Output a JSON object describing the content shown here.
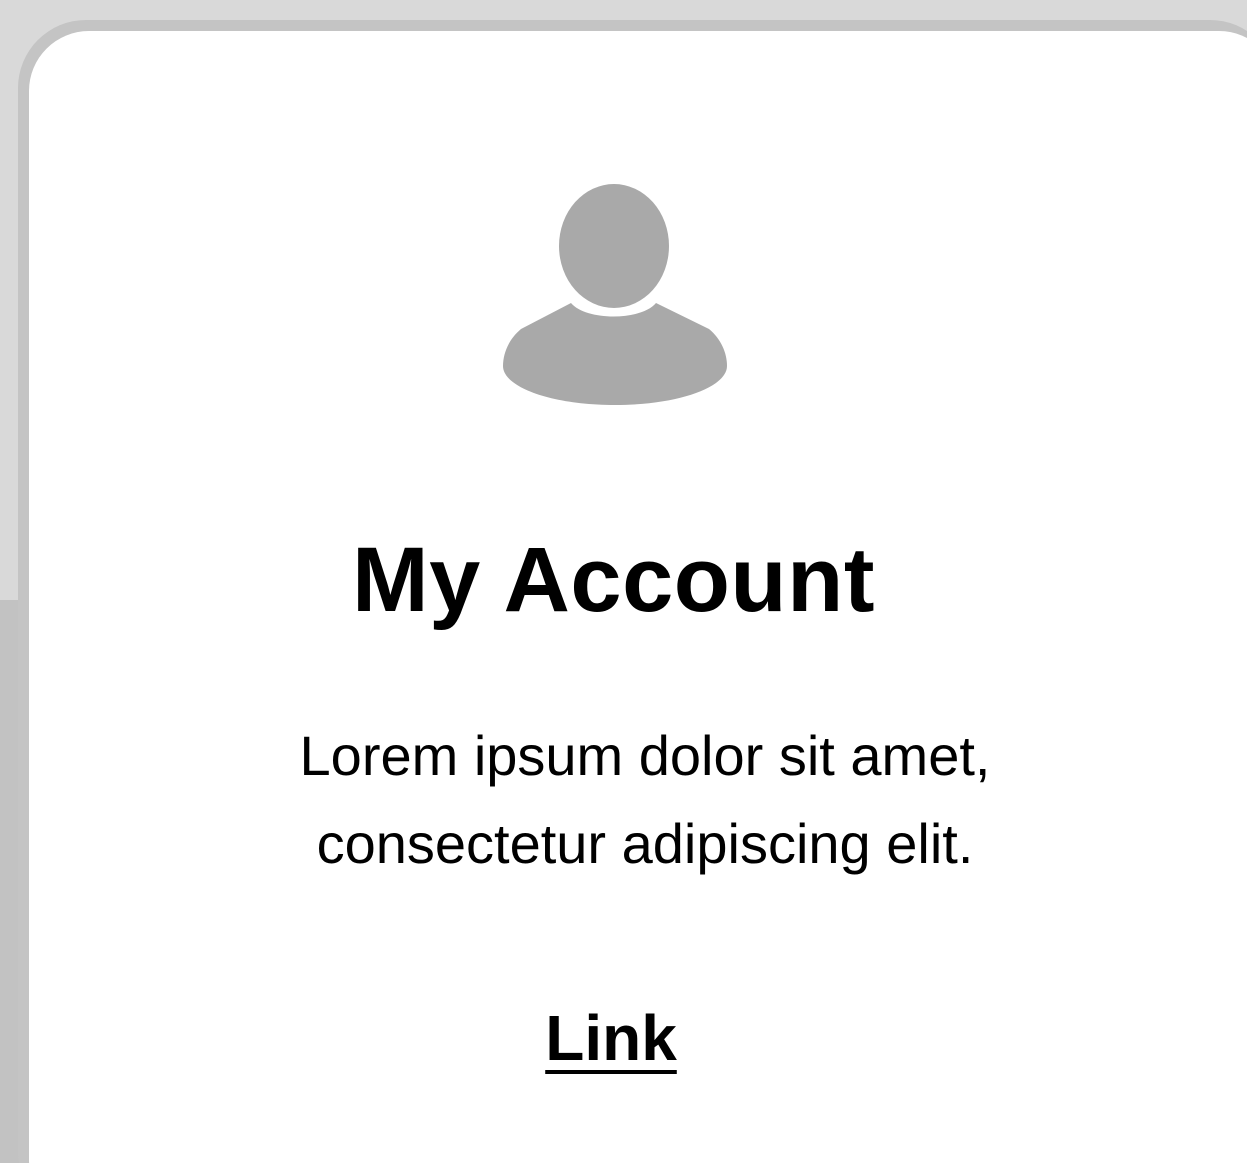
{
  "card": {
    "avatar_icon": "user-icon",
    "title": "My Account",
    "description": "Lorem ipsum dolor sit amet, consectetur adipiscing elit.",
    "link_label": "Link"
  },
  "colors": {
    "background": "#d9d9d9",
    "background_lower": "#c2c2c2",
    "card_border": "#c4c4c4",
    "card": "#ffffff",
    "icon": "#a9a9a9",
    "text": "#000000"
  }
}
